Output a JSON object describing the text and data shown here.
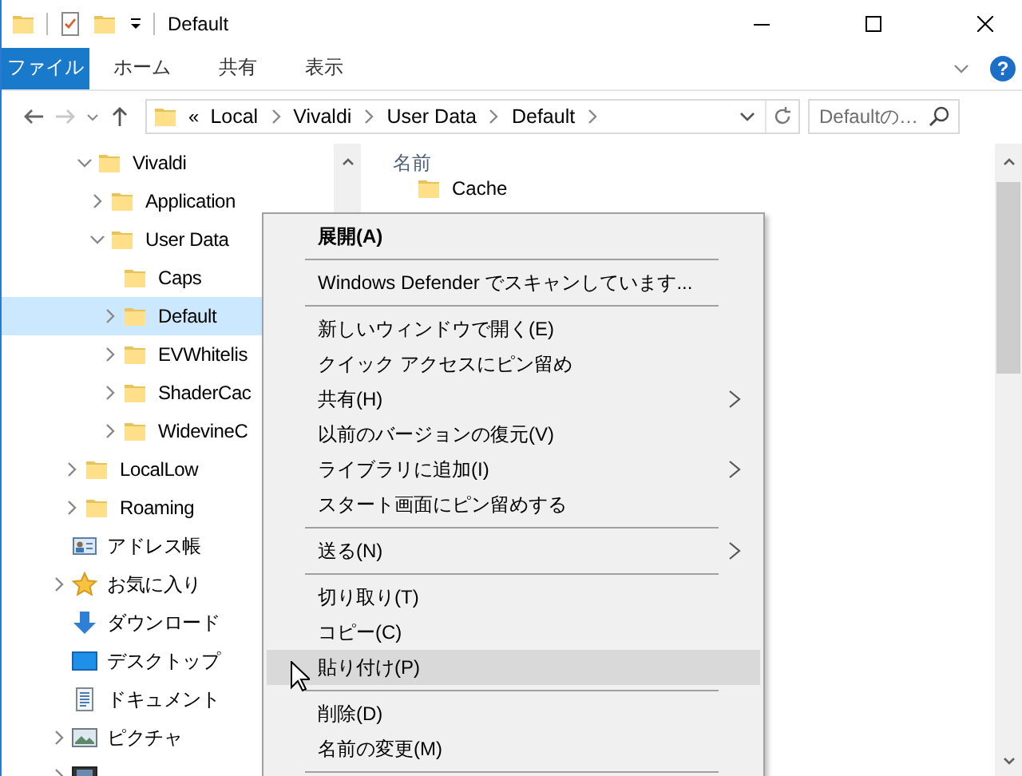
{
  "window": {
    "title": "Default"
  },
  "ribbon": {
    "tabs": [
      {
        "label": "ファイル",
        "kind": "file",
        "selected": false
      },
      {
        "label": "ホーム",
        "kind": "tab",
        "selected": false
      },
      {
        "label": "共有",
        "kind": "tab",
        "selected": false
      },
      {
        "label": "表示",
        "kind": "tab",
        "selected": false
      }
    ],
    "help": "?"
  },
  "address_bar": {
    "overflow": "«",
    "segments": [
      "Local",
      "Vivaldi",
      "User Data",
      "Default"
    ]
  },
  "search": {
    "placeholder": "Defaultの…"
  },
  "navigation_pane": {
    "tree": [
      {
        "children": [
          {
            "children": [
              {
                "label": "Vivaldi",
                "kind": "folder",
                "expanded": true,
                "selected": false,
                "children": [
                  {
                    "label": "Application",
                    "kind": "folder",
                    "expanded": false,
                    "selected": false
                  },
                  {
                    "label": "User Data",
                    "kind": "folder",
                    "expanded": true,
                    "selected": false,
                    "children": [
                      {
                        "label": "Caps",
                        "kind": "folder",
                        "selected": false
                      },
                      {
                        "label": "Default",
                        "kind": "folder",
                        "expanded": false,
                        "selected": true
                      },
                      {
                        "label": "EVWhitelis",
                        "kind": "folder",
                        "expanded": false,
                        "selected": false
                      },
                      {
                        "label": "ShaderCac",
                        "kind": "folder",
                        "expanded": false,
                        "selected": false
                      },
                      {
                        "label": "WidevineC",
                        "kind": "folder",
                        "expanded": false,
                        "selected": false
                      }
                    ]
                  }
                ]
              }
            ]
          },
          {
            "label": "LocalLow",
            "kind": "folder",
            "expanded": false,
            "selected": false
          },
          {
            "label": "Roaming",
            "kind": "folder",
            "expanded": false,
            "selected": false
          }
        ]
      },
      {
        "label": "アドレス帳",
        "kind": "contacts",
        "selected": false
      },
      {
        "label": "お気に入り",
        "kind": "favorites",
        "expanded": false,
        "selected": false
      },
      {
        "label": "ダウンロード",
        "kind": "downloads",
        "selected": false
      },
      {
        "label": "デスクトップ",
        "kind": "desktop",
        "selected": false
      },
      {
        "label": "ドキュメント",
        "kind": "documents",
        "selected": false
      },
      {
        "label": "ピクチャ",
        "kind": "pictures",
        "expanded": false,
        "selected": false
      },
      {
        "kind": "videos",
        "expanded": false,
        "selected": false
      }
    ]
  },
  "file_list": {
    "columns": [
      "名前"
    ],
    "rows": [
      {
        "name": "Cache"
      }
    ]
  },
  "context_menu": {
    "items": [
      {
        "kind": "item",
        "label": "展開(A)",
        "default": true,
        "submenu": false,
        "highlighted": false
      },
      {
        "kind": "separator"
      },
      {
        "kind": "item",
        "label": "Windows Defender でスキャンしています...",
        "default": false,
        "submenu": false,
        "highlighted": false
      },
      {
        "kind": "separator"
      },
      {
        "kind": "item",
        "label": "新しいウィンドウで開く(E)",
        "default": false,
        "submenu": false,
        "highlighted": false
      },
      {
        "kind": "item",
        "label": "クイック アクセスにピン留め",
        "default": false,
        "submenu": false,
        "highlighted": false
      },
      {
        "kind": "item",
        "label": "共有(H)",
        "default": false,
        "submenu": true,
        "highlighted": false
      },
      {
        "kind": "item",
        "label": "以前のバージョンの復元(V)",
        "default": false,
        "submenu": false,
        "highlighted": false
      },
      {
        "kind": "item",
        "label": "ライブラリに追加(I)",
        "default": false,
        "submenu": true,
        "highlighted": false
      },
      {
        "kind": "item",
        "label": "スタート画面にピン留めする",
        "default": false,
        "submenu": false,
        "highlighted": false
      },
      {
        "kind": "separator"
      },
      {
        "kind": "item",
        "label": "送る(N)",
        "default": false,
        "submenu": true,
        "highlighted": false
      },
      {
        "kind": "separator"
      },
      {
        "kind": "item",
        "label": "切り取り(T)",
        "default": false,
        "submenu": false,
        "highlighted": false
      },
      {
        "kind": "item",
        "label": "コピー(C)",
        "default": false,
        "submenu": false,
        "highlighted": false
      },
      {
        "kind": "item",
        "label": "貼り付け(P)",
        "default": false,
        "submenu": false,
        "highlighted": true
      },
      {
        "kind": "separator"
      },
      {
        "kind": "item",
        "label": "削除(D)",
        "default": false,
        "submenu": false,
        "highlighted": false
      },
      {
        "kind": "item",
        "label": "名前の変更(M)",
        "default": false,
        "submenu": false,
        "highlighted": false
      },
      {
        "kind": "separator"
      }
    ]
  }
}
